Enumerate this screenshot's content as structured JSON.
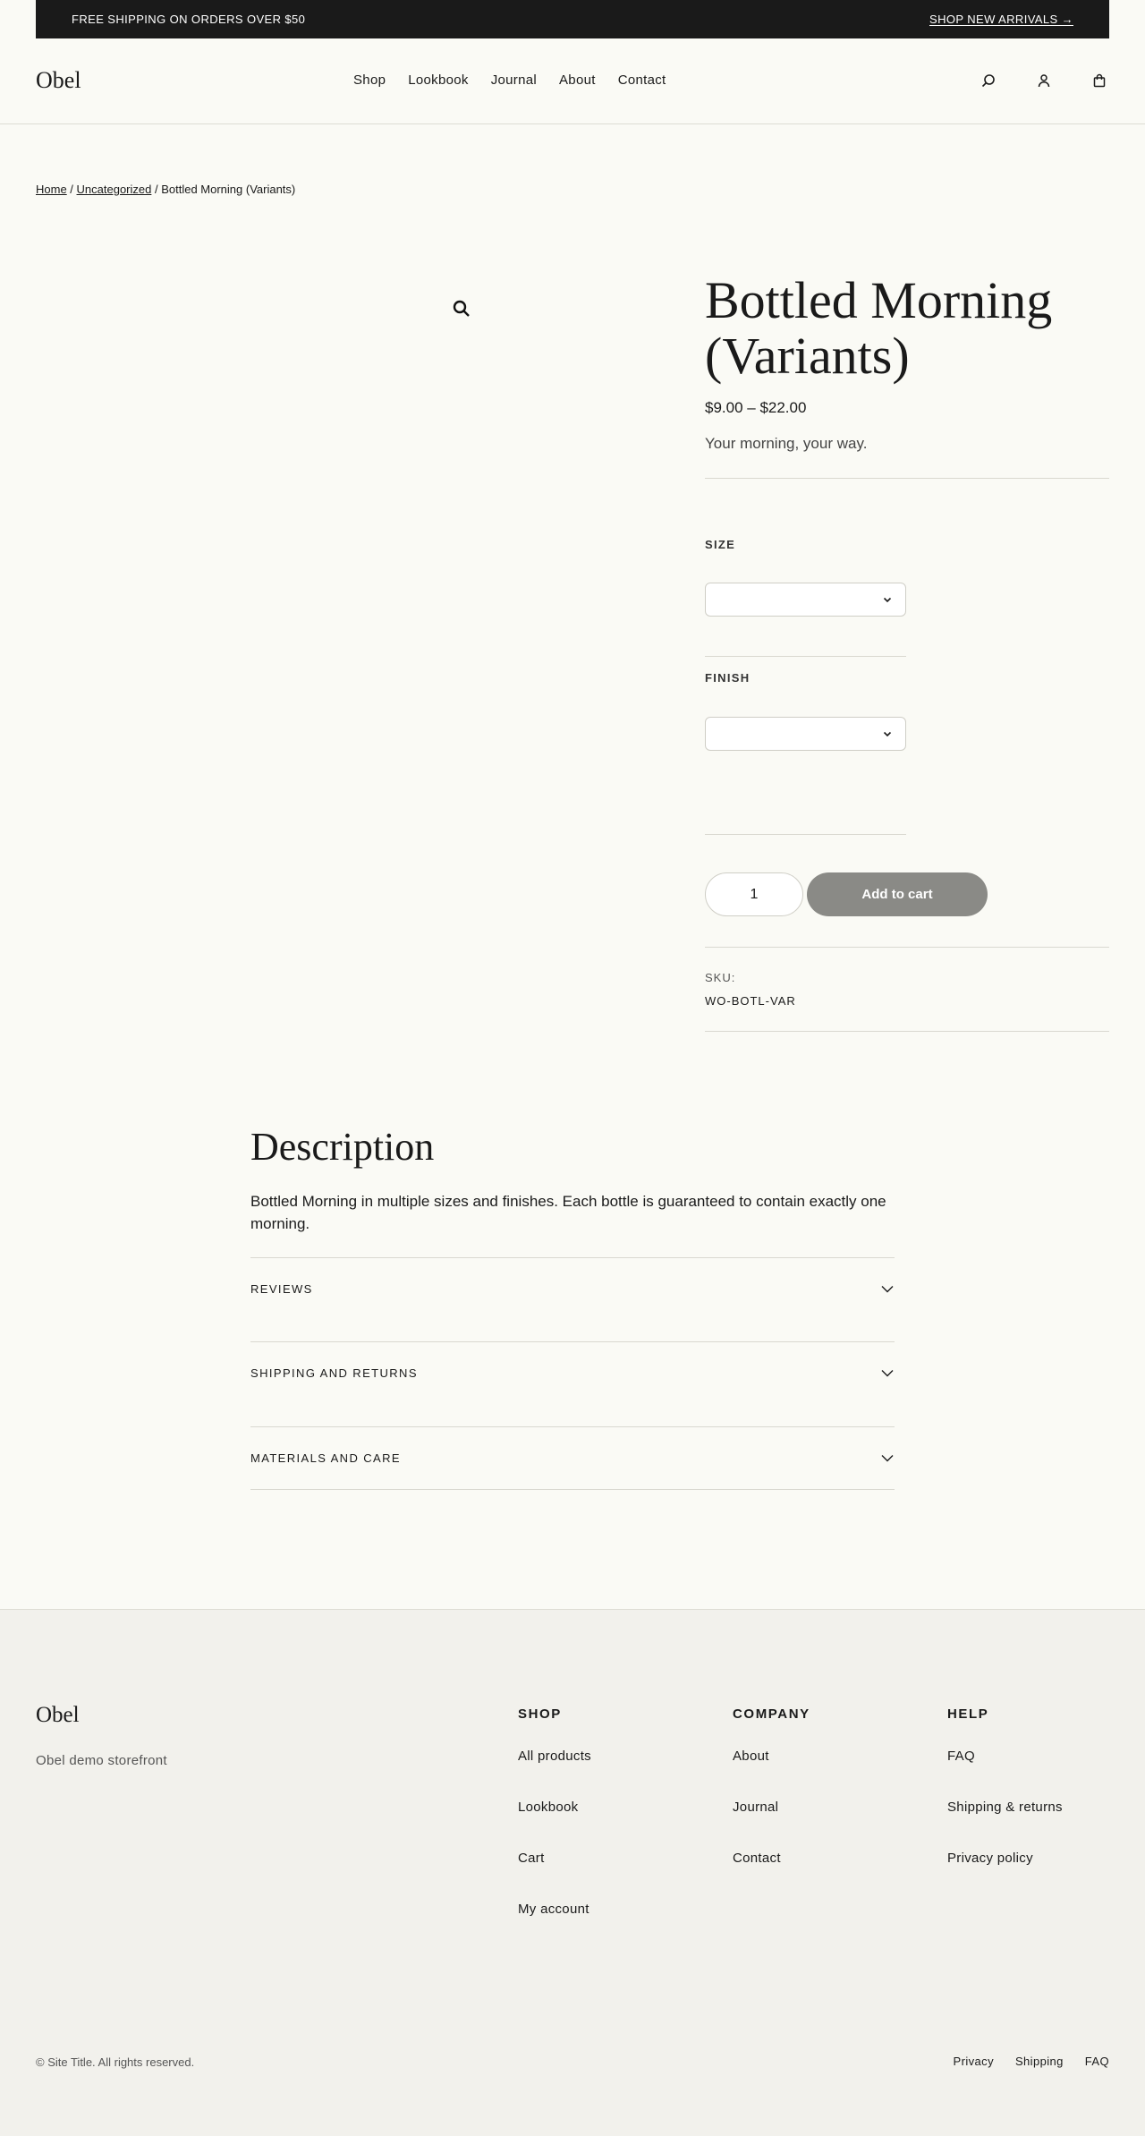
{
  "announcement": {
    "text": "FREE SHIPPING ON ORDERS OVER $50",
    "link": "SHOP NEW ARRIVALS →"
  },
  "header": {
    "logo": "Obel",
    "nav": [
      "Shop",
      "Lookbook",
      "Journal",
      "About",
      "Contact"
    ],
    "icons": [
      "search-icon",
      "account-icon",
      "cart-icon"
    ]
  },
  "breadcrumb": {
    "home": "Home",
    "sep1": " / ",
    "category": "Uncategorized",
    "sep2": " / ",
    "current": "Bottled Morning (Variants)"
  },
  "product": {
    "title": "Bottled Morning (Variants)",
    "price": "$9.00 – $22.00",
    "tagline": "Your morning, your way.",
    "size_label": "SIZE",
    "size_value": "",
    "finish_label": "FINISH",
    "finish_value": "",
    "quantity": "1",
    "add_to_cart": "Add to cart",
    "sku_label": "SKU:",
    "sku": "WO-BOTL-VAR"
  },
  "description": {
    "title": "Description",
    "text": "Bottled Morning in multiple sizes and finishes. Each bottle is guaranteed to contain exactly one morning.",
    "accordions": [
      "REVIEWS",
      "SHIPPING AND RETURNS",
      "MATERIALS AND CARE"
    ]
  },
  "footer": {
    "logo": "Obel",
    "tagline": "Obel demo storefront",
    "columns": [
      {
        "title": "SHOP",
        "links": [
          "All products",
          "Lookbook",
          "Cart",
          "My account"
        ]
      },
      {
        "title": "COMPANY",
        "links": [
          "About",
          "Journal",
          "Contact"
        ]
      },
      {
        "title": "HELP",
        "links": [
          "FAQ",
          "Shipping & returns",
          "Privacy policy"
        ]
      }
    ],
    "copyright": "© Site Title. All rights reserved.",
    "bottom_links": [
      "Privacy",
      "Shipping",
      "FAQ"
    ]
  },
  "colors": {
    "background": "#fafaf5",
    "announcement_bg": "#1a1a1a",
    "button_disabled": "#8a8a86",
    "footer_bg": "#f2f1ec"
  }
}
